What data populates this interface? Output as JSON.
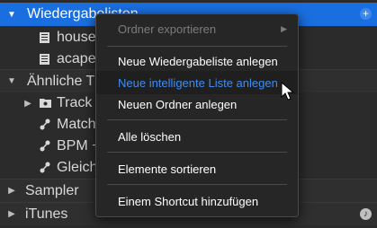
{
  "tree": {
    "playlists_label": "Wiedergabelisten",
    "playlist_items": [
      "house",
      "acape"
    ],
    "similar_label": "Ähnliche T",
    "similar_items": [
      "Track",
      "Match",
      "BPM +",
      "Gleich"
    ],
    "sampler_label": "Sampler",
    "itunes_label": "iTunes"
  },
  "menu": {
    "items": [
      "Ordner exportieren",
      "Neue Wiedergabeliste anlegen",
      "Neue intelligente Liste anlegen",
      "Neuen Ordner anlegen",
      "Alle löschen",
      "Elemente sortieren",
      "Einem Shortcut hinzufügen"
    ]
  },
  "colors": {
    "selection": "#1a6fe0",
    "menu_highlight_text": "#3d8df5"
  }
}
